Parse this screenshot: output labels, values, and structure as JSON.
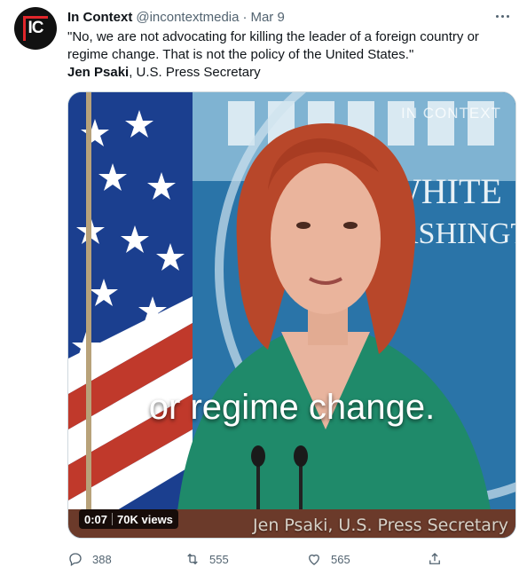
{
  "account": {
    "display_name": "In Context",
    "handle": "@incontextmedia",
    "separator": "·",
    "date": "Mar 9",
    "avatar_text": "IC"
  },
  "tweet": {
    "quote_line1": "\"No, we are not advocating for killing the leader of a foreign country or",
    "quote_line2": "regime change. That is not the policy of the United States.\"",
    "speaker_name": "Jen Psaki",
    "speaker_title": ", U.S. Press Secretary"
  },
  "video": {
    "watermark": "IN CONTEXT",
    "caption": "or regime change.",
    "lower_third": "Jen Psaki, U.S. Press Secretary",
    "duration": "0:07",
    "views": "70K views",
    "backdrop_text_1": "WHITE",
    "backdrop_text_2": "ASHINGT"
  },
  "actions": {
    "reply_count": "388",
    "retweet_count": "555",
    "like_count": "565"
  },
  "icons": {
    "more": "more-icon",
    "reply": "reply-icon",
    "retweet": "retweet-icon",
    "like": "heart-icon",
    "share": "share-icon"
  },
  "colors": {
    "text": "#0f1419",
    "secondary": "#536471",
    "accent": "#e0262b",
    "dress": "#1f8a6a",
    "hair": "#b8472a",
    "backdrop": "#2a74a8"
  }
}
